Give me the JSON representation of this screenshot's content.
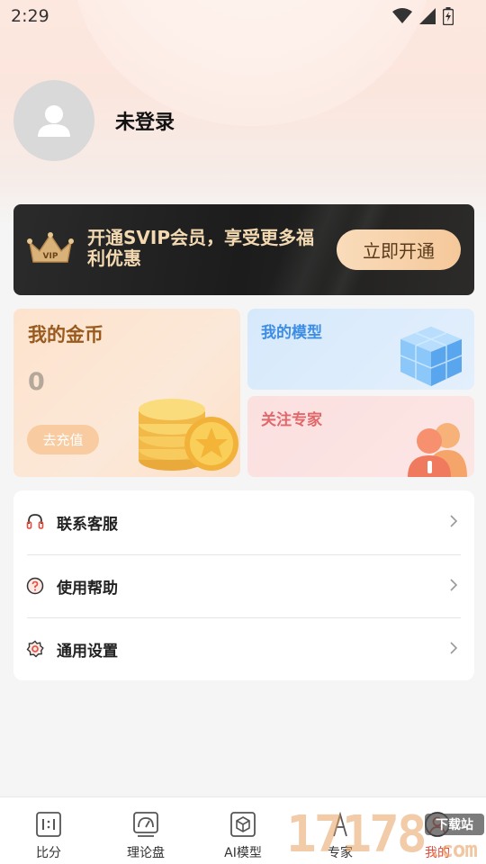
{
  "status_bar": {
    "time": "2:29"
  },
  "profile": {
    "username": "未登录"
  },
  "vip_banner": {
    "title": "开通SVIP会员，享受更多福利优惠",
    "badge_text": "VIP",
    "button_label": "立即开通"
  },
  "coins": {
    "title": "我的金币",
    "value": "0",
    "button_label": "去充值"
  },
  "my_models": {
    "title": "我的模型"
  },
  "follow_experts": {
    "title": "关注专家"
  },
  "menu": {
    "items": [
      {
        "label": "联系客服",
        "icon": "headset-icon"
      },
      {
        "label": "使用帮助",
        "icon": "help-icon"
      },
      {
        "label": "通用设置",
        "icon": "gear-icon"
      }
    ]
  },
  "tabbar": {
    "tabs": [
      {
        "label": "比分",
        "icon": "score-icon"
      },
      {
        "label": "理论盘",
        "icon": "gauge-icon"
      },
      {
        "label": "AI模型",
        "icon": "cube-icon"
      },
      {
        "label": "专家",
        "icon": "expert-icon"
      },
      {
        "label": "我的",
        "icon": "user-icon"
      }
    ],
    "active_index": 4
  },
  "watermark": {
    "text": "17178",
    "badge": "下载站",
    "suffix": ".com"
  },
  "colors": {
    "accent_red": "#e24a3b",
    "vip_gold": "#f3d9b1",
    "coins_brown": "#9a5a1e",
    "model_blue": "#3d8de4",
    "expert_red": "#e0686a"
  }
}
